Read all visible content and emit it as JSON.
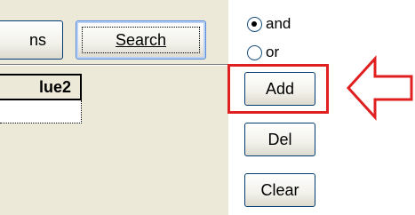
{
  "toolbar": {
    "left_button_label": "ns",
    "search_button_label": "Search"
  },
  "grid": {
    "column_header": "lue2"
  },
  "logic": {
    "and_label": "and",
    "or_label": "or",
    "selected": "and"
  },
  "actions": {
    "add_label": "Add",
    "del_label": "Del",
    "clear_label": "Clear"
  },
  "annotation": {
    "highlight_color": "#e02020",
    "highlight_target": "Add"
  }
}
